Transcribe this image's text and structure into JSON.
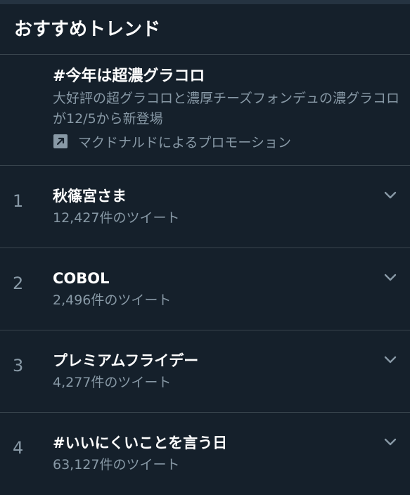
{
  "header": {
    "title": "おすすめトレンド"
  },
  "promoted": {
    "title": "#今年は超濃グラコロ",
    "description": "大好評の超グラコロと濃厚チーズフォンデュの濃グラコロが12/5から新登場",
    "promoted_by": "マクドナルドによるプロモーション",
    "icon": "promoted-arrow-icon"
  },
  "trends": [
    {
      "rank": "1",
      "name": "秋篠宮さま",
      "count": "12,427件のツイート"
    },
    {
      "rank": "2",
      "name": "COBOL",
      "count": "2,496件のツイート"
    },
    {
      "rank": "3",
      "name": "プレミアムフライデー",
      "count": "4,277件のツイート"
    },
    {
      "rank": "4",
      "name": "#いいにくいことを言う日",
      "count": "63,127件のツイート"
    }
  ],
  "colors": {
    "background": "#15202b",
    "divider": "#38444d",
    "secondary_text": "#8899a6",
    "primary_text": "#ffffff"
  }
}
